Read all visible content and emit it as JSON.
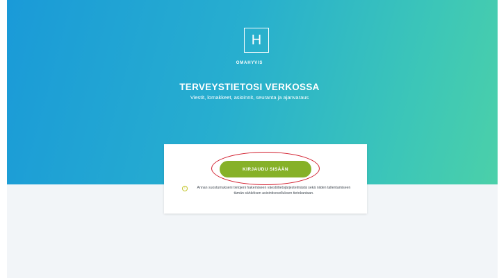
{
  "logo": {
    "letter": "H",
    "brand": "OMAHYVIS"
  },
  "hero": {
    "title": "TERVEYSTIETOSI VERKOSSA",
    "subtitle": "Viestit, lomakkeet, asioinnit, seuranta ja ajanvaraus"
  },
  "login": {
    "button_label": "KIRJAUDU SISÄÄN",
    "consent_text": "Annan suostumukseni tietojeni hakemiseen väestötietojärjestelmästä sekä niiden tallentamiseen tämän sähköisen asiointisovelluksen tietokantaan."
  },
  "icons": {
    "consent": "info-icon",
    "highlight": "red-ellipse-annotation"
  },
  "colors": {
    "gradient_start": "#1a9ad8",
    "gradient_end": "#4bd0a9",
    "button": "#86b128",
    "highlight": "#d11a2a",
    "background": "#f2f5f8"
  }
}
